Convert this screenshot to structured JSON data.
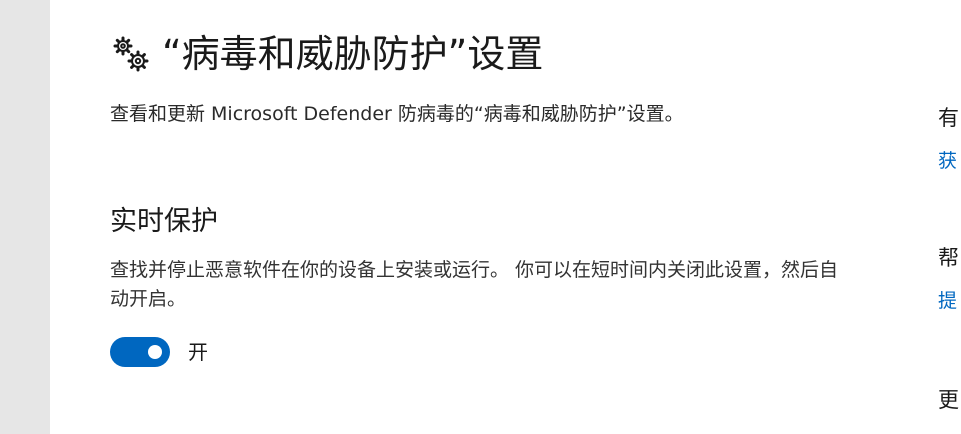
{
  "header": {
    "title": "“病毒和威胁防护”设置",
    "icon": "gears-icon"
  },
  "subtitle": "查看和更新 Microsoft Defender 防病毒的“病毒和威胁防护”设置。",
  "realtime": {
    "title": "实时保护",
    "description": "查找并停止恶意软件在你的设备上安装或运行。 你可以在短时间内关闭此设置，然后自动开启。",
    "toggle_state": "开",
    "toggle_on": true
  },
  "right_panel": {
    "items": [
      {
        "text": "有",
        "kind": "heading"
      },
      {
        "text": "获",
        "kind": "link"
      },
      {
        "text": "帮",
        "kind": "heading"
      },
      {
        "text": "提",
        "kind": "link"
      },
      {
        "text": "更",
        "kind": "heading"
      }
    ]
  },
  "colors": {
    "accent": "#0067c0",
    "gutter": "#e6e6e6"
  }
}
